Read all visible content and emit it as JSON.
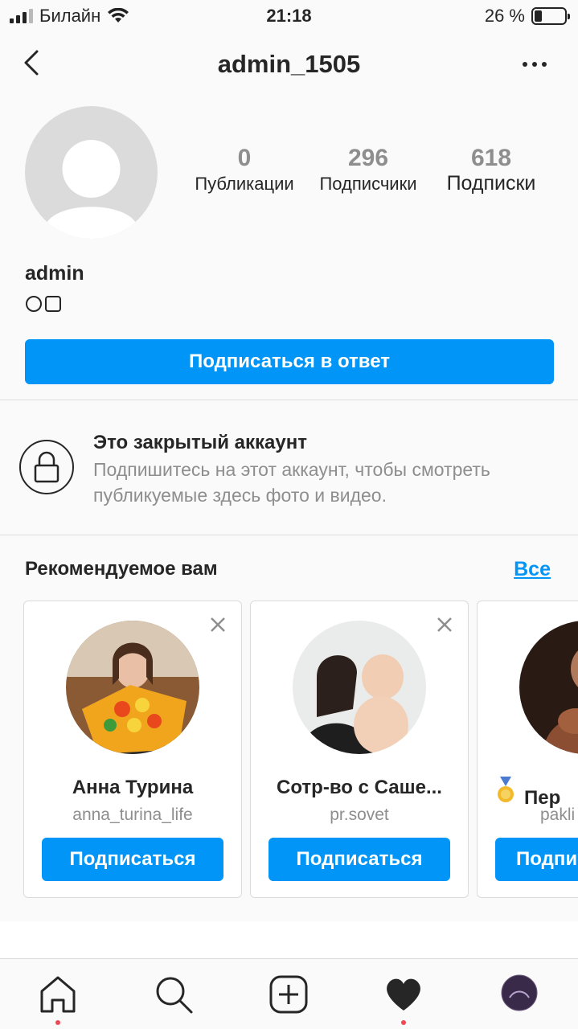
{
  "status_bar": {
    "carrier": "Билайн",
    "time": "21:18",
    "battery": "26 %",
    "battery_level": 0.26
  },
  "header": {
    "title": "admin_1505",
    "back_icon": "chevron-left-icon",
    "more_icon": "more-horizontal-icon"
  },
  "profile": {
    "stats": [
      {
        "value": "0",
        "label": "Публикации"
      },
      {
        "value": "296",
        "label": "Подписчики"
      },
      {
        "value": "618",
        "label": "Подписки"
      }
    ],
    "display_name": "admin",
    "bio_symbols": "○□",
    "follow_back_label": "Подписаться в ответ"
  },
  "private_account": {
    "title": "Это закрытый аккаунт",
    "text": "Подпишитесь на этот аккаунт, чтобы смотреть публикуемые здесь фото и видео."
  },
  "suggestions": {
    "title": "Рекомендуемое вам",
    "see_all": "Все",
    "cards": [
      {
        "name": "Анна Турина",
        "handle": "anna_turina_life",
        "button": "Подписаться"
      },
      {
        "name": "Сотр-во с Саше...",
        "handle": "pr.sovet",
        "button": "Подписаться"
      },
      {
        "name": "Пер",
        "handle": "pakli",
        "button": "Подпи"
      }
    ]
  },
  "tabbar": {
    "items": [
      "home-icon",
      "search-icon",
      "new-post-icon",
      "activity-heart-icon",
      "profile-avatar"
    ]
  },
  "colors": {
    "accent": "#0095f6",
    "text": "#262626",
    "secondary": "#8e8e8e",
    "notification_dot": "#ed4956"
  }
}
